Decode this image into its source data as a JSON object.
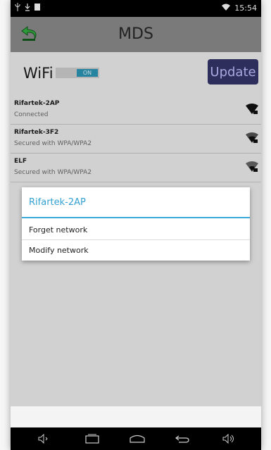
{
  "status_bar": {
    "time": "15:54",
    "icons": [
      "usb-icon",
      "download-icon",
      "notification-icon",
      "wifi-icon"
    ]
  },
  "app_bar": {
    "title": "MDS",
    "back_icon": "back-arrow-icon"
  },
  "wifi": {
    "label": "WiFi",
    "toggle_state": "ON",
    "update_label": "Update"
  },
  "networks": [
    {
      "name": "Rifartek-2AP",
      "status": "Connected"
    },
    {
      "name": "Rifartek-3F2",
      "status": "Secured with WPA/WPA2"
    },
    {
      "name": "ELF",
      "status": "Secured with WPA/WPA2"
    }
  ],
  "dialog": {
    "title": "Rifartek-2AP",
    "options": [
      "Forget network",
      "Modify network"
    ]
  },
  "nav_bar": {
    "icons": [
      "volume-down-icon",
      "recent-apps-icon",
      "home-icon",
      "back-icon",
      "volume-up-icon"
    ]
  },
  "colors": {
    "accent": "#32a1d1",
    "update_button": "#35356a",
    "app_bar": "#7a7a7a"
  }
}
